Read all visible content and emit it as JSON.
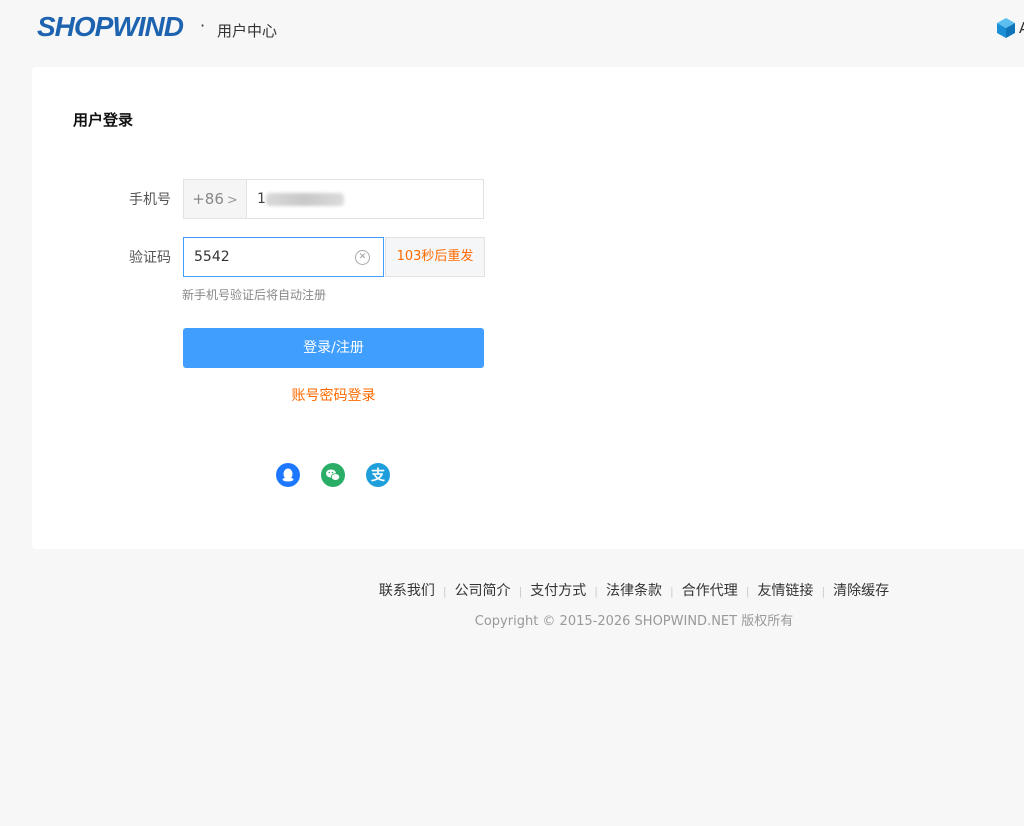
{
  "header": {
    "logo_text": "SHOPWIND",
    "dot": "·",
    "subtitle": "用户中心",
    "right_text_partial": "A"
  },
  "login": {
    "title": "用户登录",
    "phone_label": "手机号",
    "country_code": "+86",
    "phone_value": "1",
    "code_label": "验证码",
    "code_value": "5542",
    "resend_label": "103秒后重发",
    "hint": "新手机号验证后将自动注册",
    "submit_label": "登录/注册",
    "alt_login_label": "账号密码登录",
    "social_icons": [
      "qq-icon",
      "wechat-icon",
      "alipay-icon"
    ]
  },
  "footer": {
    "links": [
      "联系我们",
      "公司简介",
      "支付方式",
      "法律条款",
      "合作代理",
      "友情链接",
      "清除缓存"
    ],
    "copyright": "Copyright © 2015-2026 SHOPWIND.NET 版权所有"
  },
  "colors": {
    "primary": "#409eff",
    "accent": "#ff6a00",
    "logo": "#1e63b0"
  }
}
